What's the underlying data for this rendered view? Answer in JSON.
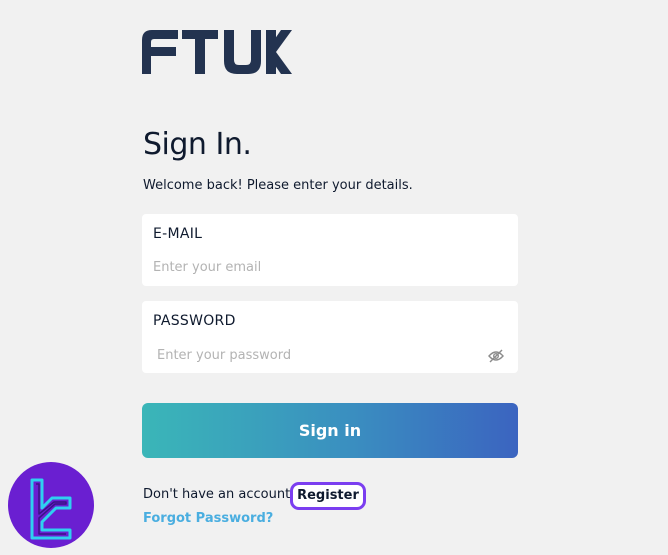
{
  "brand": {
    "logo_text": "FTUK",
    "logo_color": "#233350"
  },
  "signin": {
    "title": "Sign In.",
    "subtitle": "Welcome back! Please enter your details.",
    "email_label": "E-MAIL",
    "email_placeholder": "Enter your email",
    "password_label": "PASSWORD",
    "password_placeholder": "Enter your password",
    "password_toggle_icon": "eye-off-icon",
    "button_label": "Sign in",
    "button_gradient": [
      "#3ab6b8",
      "#3b64c0"
    ]
  },
  "footer": {
    "account_prompt": "Don't have an account",
    "register_label": "Register",
    "forgot_label": "Forgot Password?",
    "highlight_color": "#7b3ef0"
  },
  "watermark": {
    "icon": "tc-badge-icon",
    "color": "#6a1fd1"
  }
}
